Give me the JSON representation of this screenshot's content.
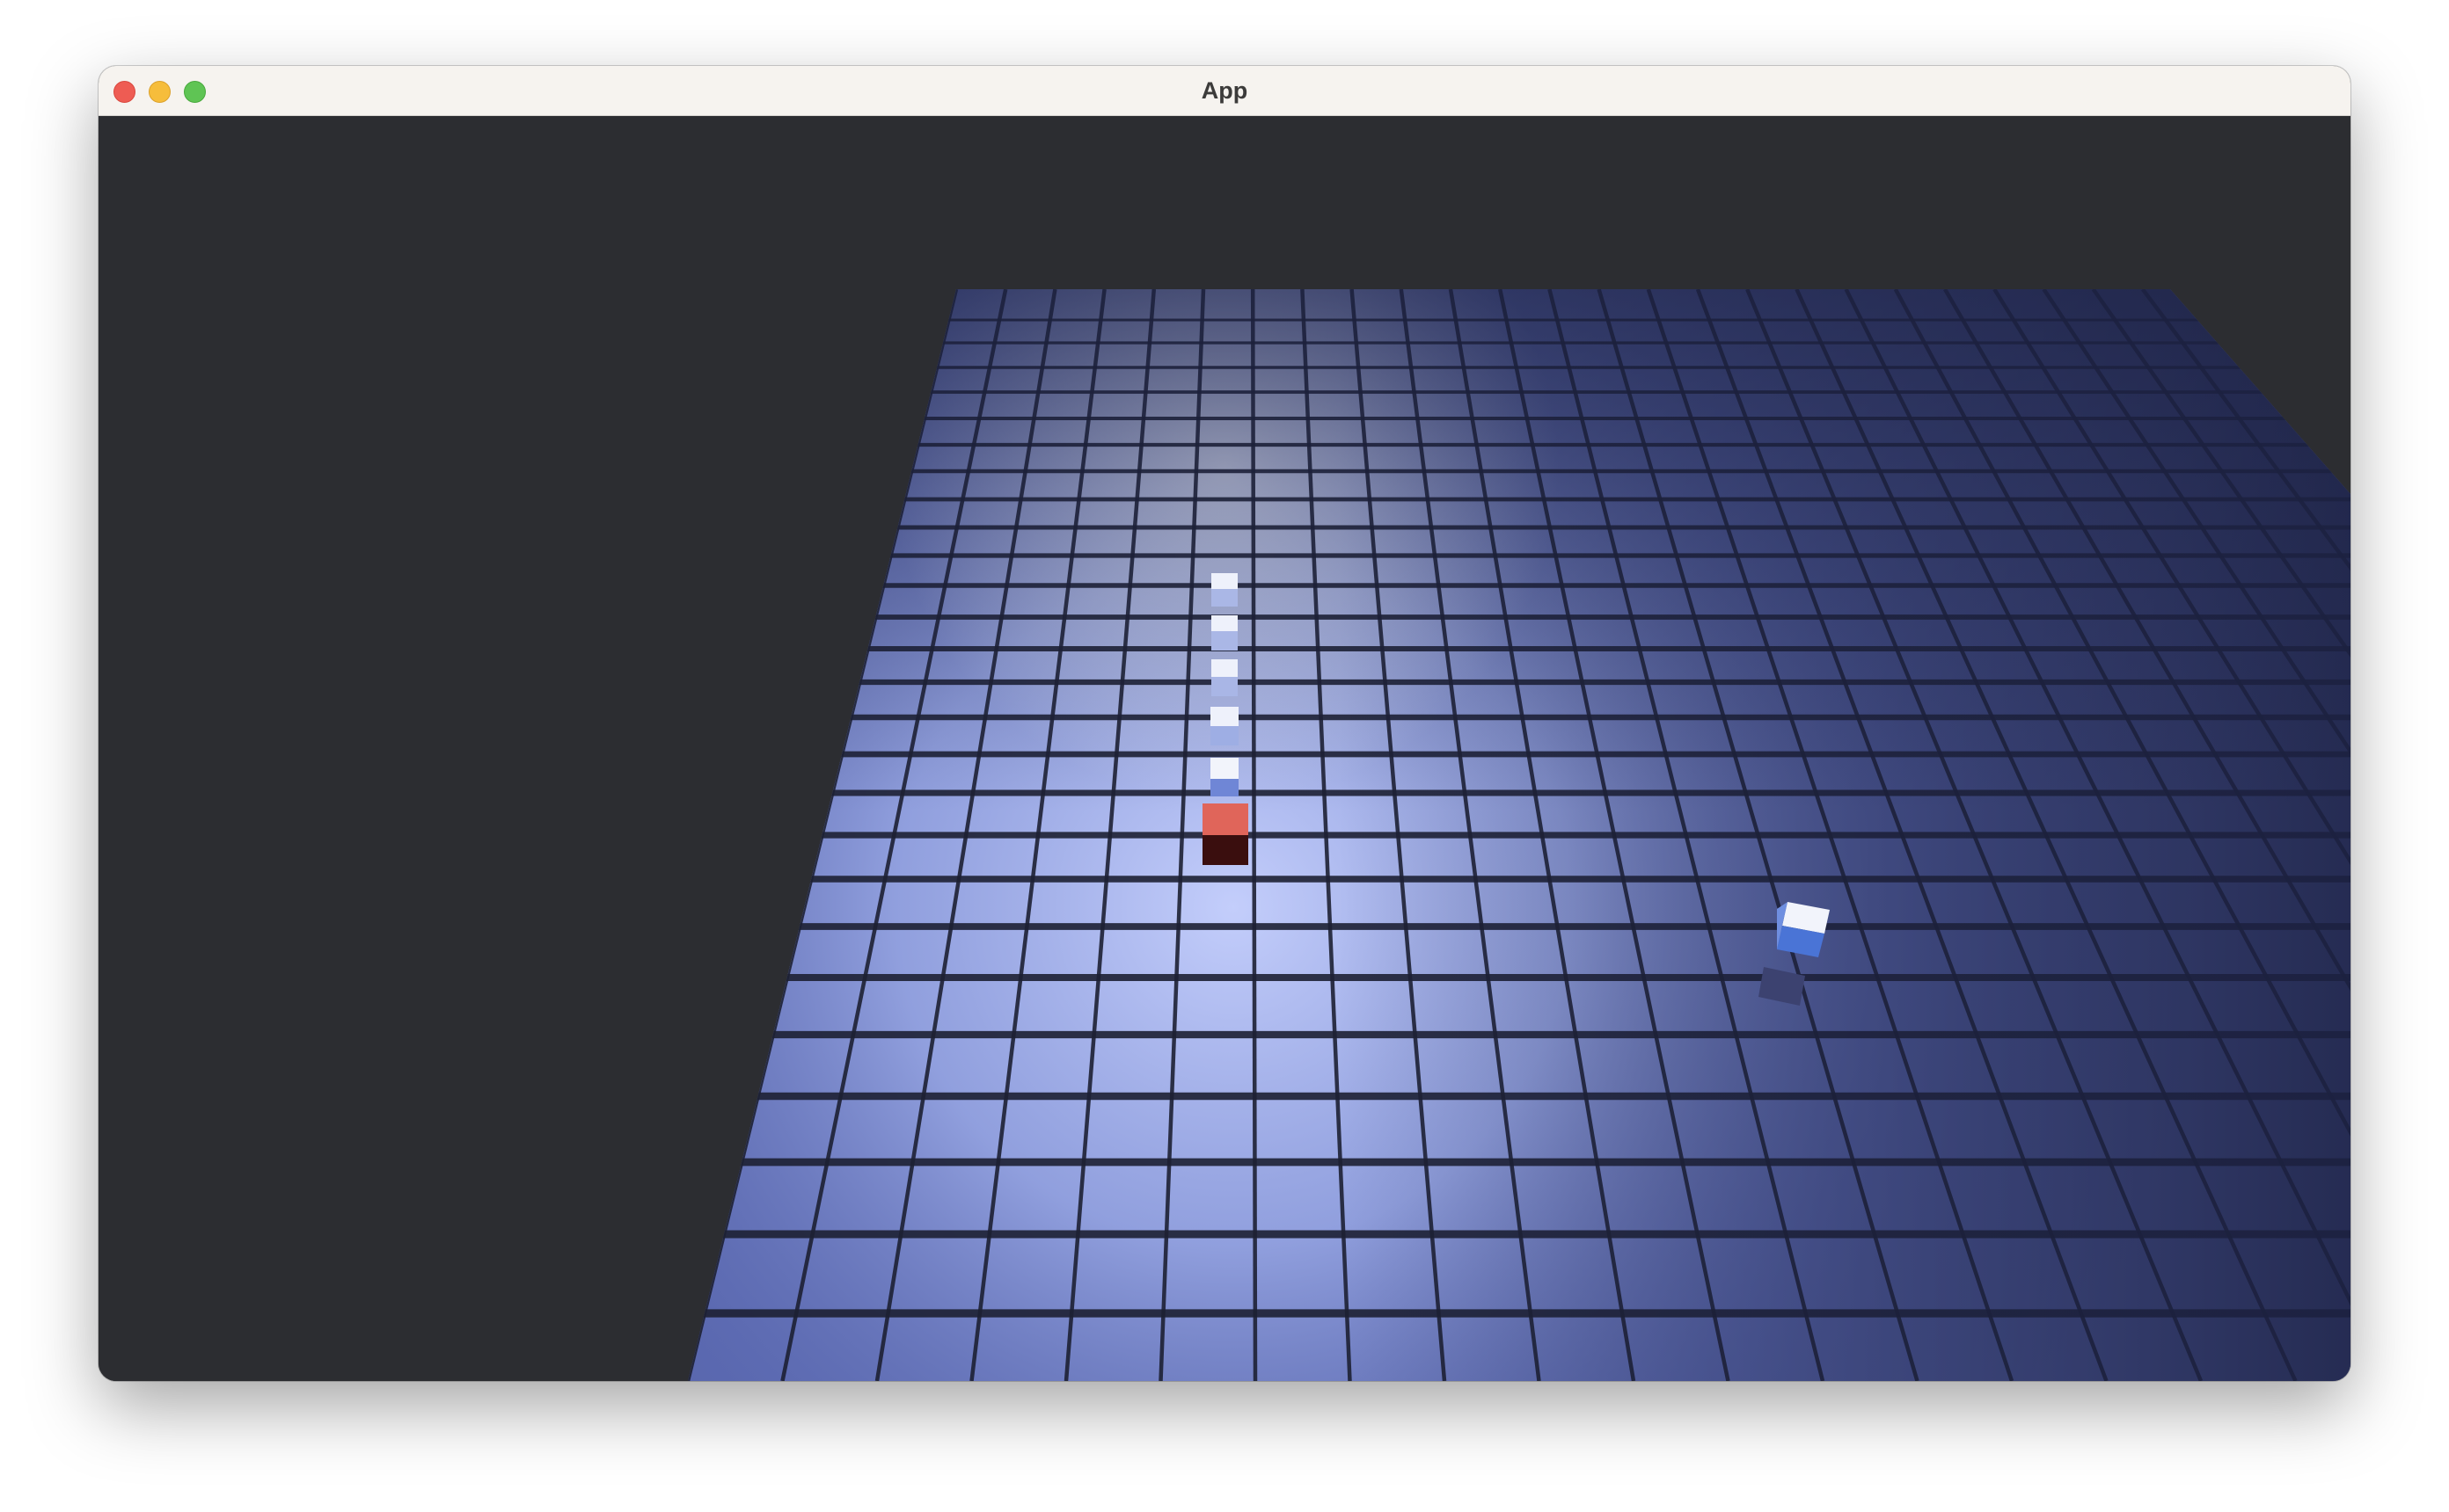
{
  "window": {
    "title": "App",
    "buttons": {
      "close": "close",
      "minimize": "minimize",
      "maximize": "maximize"
    }
  },
  "scene": {
    "background_color": "#2c2d31",
    "board_color": "#6f7fc8",
    "grid_line_color": "#1d2033",
    "light_color": "#c7d3ff",
    "snake": {
      "segment_color": "#e6eaf7",
      "head_color": "#e0655a",
      "head_shadow_color": "#3a0e0e"
    },
    "food": {
      "top_color": "#f2f4fb",
      "side_color": "#4a74d6",
      "shadow_color": "#3a3f63"
    }
  }
}
